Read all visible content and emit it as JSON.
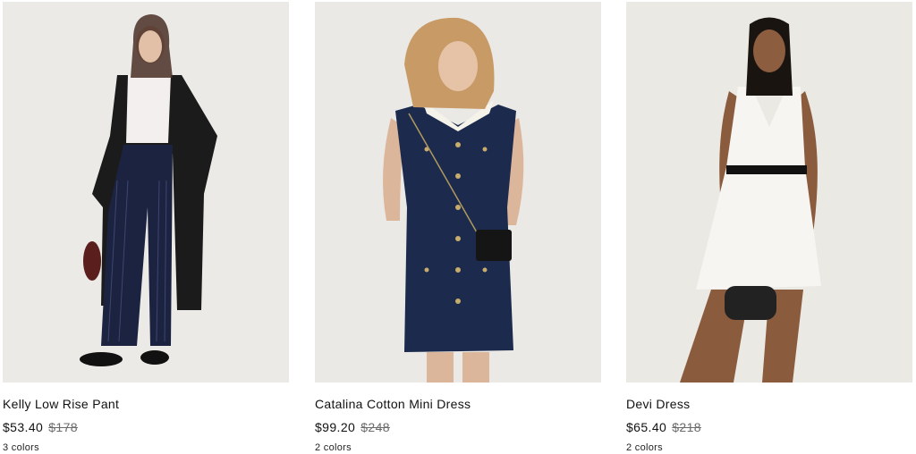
{
  "products": [
    {
      "name": "Kelly Low Rise Pant",
      "sale_price": "$53.40",
      "original_price": "$178",
      "colors": "3 colors",
      "image_desc_icon": "product-photo-kelly-low-rise-pant"
    },
    {
      "name": "Catalina Cotton Mini Dress",
      "sale_price": "$99.20",
      "original_price": "$248",
      "colors": "2 colors",
      "image_desc_icon": "product-photo-catalina-cotton-mini-dress"
    },
    {
      "name": "Devi Dress",
      "sale_price": "$65.40",
      "original_price": "$218",
      "colors": "2 colors",
      "image_desc_icon": "product-photo-devi-dress"
    }
  ],
  "colors": {
    "photo_background": "#ecebe8",
    "text": "#111111",
    "strikethrough": "#6b6b6b"
  }
}
